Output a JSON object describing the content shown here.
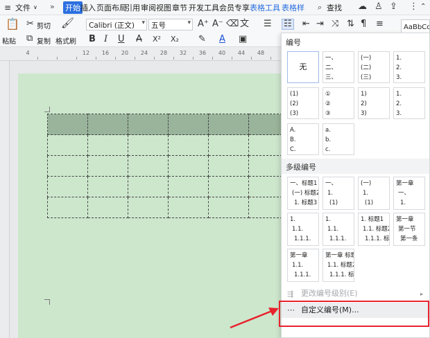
{
  "menubar": {
    "file": "文件",
    "file_caret": "∨",
    "more": "»",
    "tabs": [
      "开始",
      "插入",
      "页面布局",
      "引用",
      "审阅",
      "视图",
      "章节",
      "开发工具",
      "会员专享"
    ],
    "active_tab": "开始",
    "context_tabs": [
      "表格工具",
      "表格样"
    ],
    "search": "查找"
  },
  "ribbon": {
    "paste": "粘贴",
    "cut": "剪切",
    "copy": "复制",
    "format_painter": "格式刷",
    "font_name": "Calibri (正文)",
    "font_size": "五号",
    "bold": "B",
    "italic": "I",
    "underline": "U",
    "strike": "A",
    "superscript": "X²",
    "subscript": "X₂",
    "style_preview": "AaBbCc"
  },
  "ruler": {
    "numbers": [
      "4",
      "",
      "",
      "12",
      "16",
      "20",
      "24",
      "28",
      "32",
      "36",
      "40",
      "44",
      "48"
    ]
  },
  "dropdown": {
    "section_numbering": "编号",
    "none_label": "无",
    "single_items": [
      {
        "lines": [
          "一、",
          "二、",
          "三、"
        ]
      },
      {
        "lines": [
          "(一)",
          "(二)",
          "(三)"
        ]
      },
      {
        "lines": [
          "1.",
          "2.",
          "3."
        ]
      },
      {
        "lines": [
          "(1)",
          "(2)",
          "(3)"
        ]
      },
      {
        "lines": [
          "①",
          "②",
          "③"
        ]
      },
      {
        "lines": [
          "1)",
          "2)",
          "3)"
        ]
      },
      {
        "lines": [
          "1.",
          "2.",
          "3."
        ]
      },
      {
        "lines": [
          "A.",
          "B.",
          "C."
        ]
      },
      {
        "lines": [
          "a.",
          "b.",
          "c."
        ]
      }
    ],
    "section_multilevel": "多级编号",
    "multi_items": [
      {
        "lines": [
          "一、标题1",
          "(一) 标题2",
          "1. 标题3"
        ]
      },
      {
        "lines": [
          "一、",
          "1.",
          "(1)"
        ]
      },
      {
        "lines": [
          "(一)",
          "1.",
          "(1)"
        ]
      },
      {
        "lines": [
          "第一章",
          "一、",
          "1."
        ]
      },
      {
        "lines": [
          "1.",
          "1.1.",
          "1.1.1."
        ]
      },
      {
        "lines": [
          "1.",
          "1.1.",
          "1.1.1."
        ]
      },
      {
        "lines": [
          "1. 标题1",
          "1.1. 标题2",
          "1.1.1. 标题3"
        ]
      },
      {
        "lines": [
          "第一章",
          "第一节",
          "第一条"
        ]
      },
      {
        "lines": [
          "第一章",
          "1.1.",
          "1.1.1."
        ]
      },
      {
        "lines": [
          "第一章 标题1",
          "1.1. 标题2",
          "1.1.1. 标题3"
        ]
      }
    ],
    "change_level": "更改编号级别(E)",
    "custom_numbering": "自定义编号(M)..."
  },
  "colors": {
    "accent": "#2b6fe0",
    "page_bg": "#cde7cd",
    "header_row": "#99b49a",
    "highlight": "#e8232e"
  }
}
